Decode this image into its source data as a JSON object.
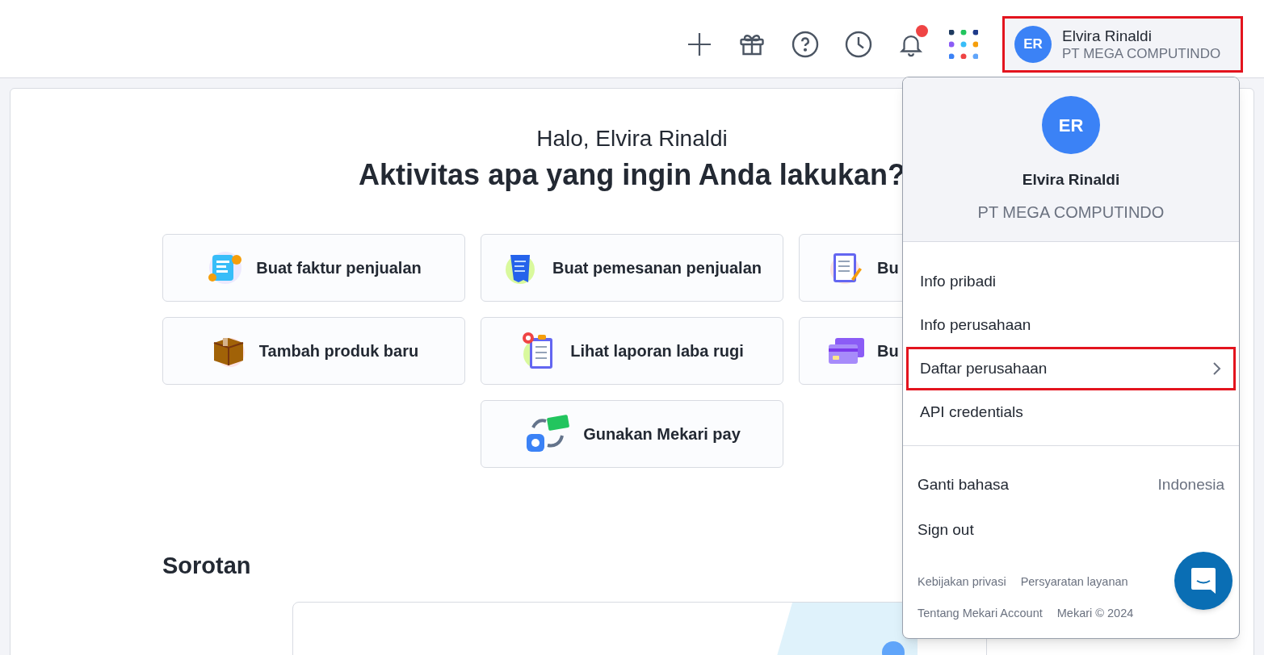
{
  "header": {
    "user": {
      "initials": "ER",
      "name": "Elvira Rinaldi",
      "company": "PT MEGA COMPUTINDO",
      "highlighted": true
    },
    "notification_badge": true
  },
  "main": {
    "greeting": "Halo, Elvira Rinaldi",
    "question": "Aktivitas apa yang ingin Anda lakukan?",
    "action_rows": [
      [
        {
          "kind": "invoice",
          "label": "Buat faktur penjualan"
        },
        {
          "kind": "order",
          "label": "Buat pemesanan penjualan"
        },
        {
          "kind": "notepad",
          "label": "Bu"
        }
      ],
      [
        {
          "kind": "box",
          "label": "Tambah produk baru"
        },
        {
          "kind": "report",
          "label": "Lihat laporan laba rugi"
        },
        {
          "kind": "card",
          "label": "Bu"
        }
      ],
      [
        {
          "kind": "pay",
          "label": "Gunakan Mekari pay"
        }
      ]
    ],
    "section_title": "Sorotan"
  },
  "profile_menu": {
    "initials": "ER",
    "name": "Elvira Rinaldi",
    "company": "PT MEGA COMPUTINDO",
    "items": [
      {
        "label": "Info pribadi",
        "highlighted": false,
        "submenu": false
      },
      {
        "label": "Info perusahaan",
        "highlighted": false,
        "submenu": false
      },
      {
        "label": "Daftar perusahaan",
        "highlighted": true,
        "submenu": true
      },
      {
        "label": "API credentials",
        "highlighted": false,
        "submenu": false
      }
    ],
    "language": {
      "label": "Ganti bahasa",
      "value": "Indonesia"
    },
    "sign_out": "Sign out",
    "footer_links": [
      [
        "Kebijakan privasi",
        "Persyaratan layanan"
      ],
      [
        "Tentang Mekari Account",
        "Mekari © 2024"
      ]
    ]
  }
}
